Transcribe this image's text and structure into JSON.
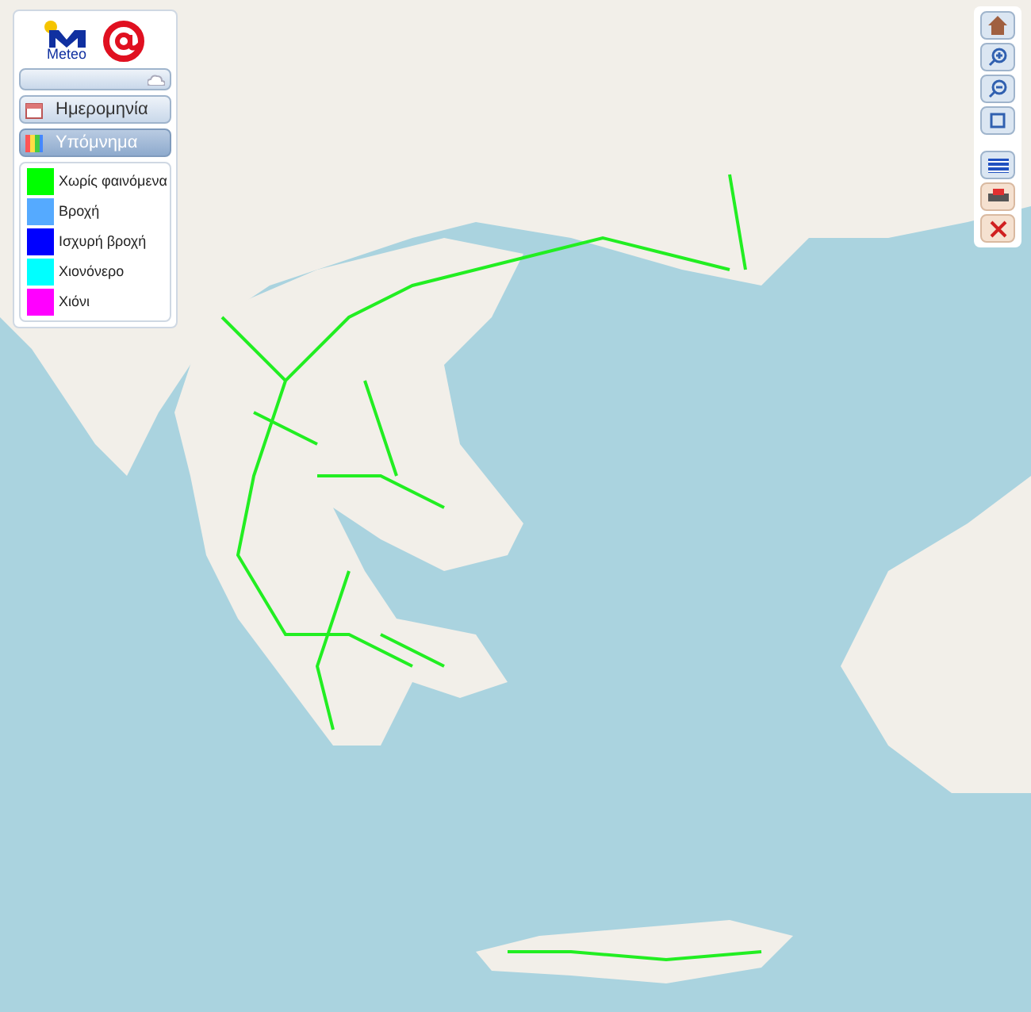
{
  "logo": {
    "text": "Meteo"
  },
  "sections": [
    {
      "label": "Ημερομηνία",
      "kind": "date",
      "expanded": false
    },
    {
      "label": "Υπόμνημα",
      "kind": "legend",
      "expanded": true
    }
  ],
  "legend": [
    {
      "label": "Χωρίς φαινόμενα",
      "color": "#00ff00"
    },
    {
      "label": "Βροχή",
      "color": "#55aaff"
    },
    {
      "label": "Ισχυρή βροχή",
      "color": "#0000ff"
    },
    {
      "label": "Χιονόνερο",
      "color": "#00ffff"
    },
    {
      "label": "Χιόνι",
      "color": "#ff00ff"
    }
  ]
}
